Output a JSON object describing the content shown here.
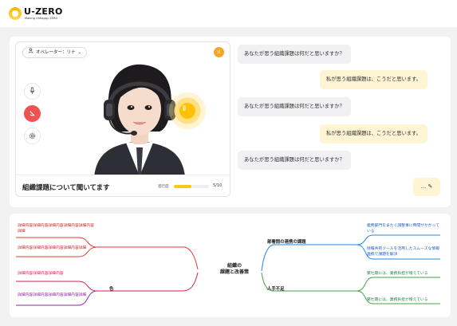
{
  "brand": {
    "name": "U-ZERO",
    "tagline": "Making Unhappy ZERO"
  },
  "video": {
    "operator_label": "オペレーター：リナ",
    "caption": "組織課題について聞いてます",
    "progress_label": "進行度",
    "progress_text": "5/10",
    "progress_fraction": 0.5
  },
  "chat": {
    "messages": [
      {
        "role": "assistant",
        "text": "あなたが思う組織課題は何だと思いますか？"
      },
      {
        "role": "user",
        "text": "私が思う組織課題は、こうだと思います。"
      },
      {
        "role": "assistant",
        "text": "あなたが思う組織課題は何だと思いますか？"
      },
      {
        "role": "user",
        "text": "私が思う組織課題は、こうだと思います。"
      },
      {
        "role": "assistant",
        "text": "あなたが思う組織課題は何だと思いますか？"
      }
    ],
    "compose_label": "..."
  },
  "mindmap": {
    "center": "組織の\n課題と改善策",
    "left_label": "色",
    "left_items": [
      "詳細内容詳細内容詳細内容詳細内容詳細内容詳細",
      "詳細内容詳細内容詳細内容詳細内容詳細",
      "詳細内容詳細内容詳細内容",
      "詳細内容詳細内容詳細内容詳細内容詳細"
    ],
    "right_branches": [
      {
        "label": "部署間の連携の課題",
        "items": [
          "義務部門をまたぐ調整事に時間がかかっている",
          "情報共有ツールを活用したスムーズな情報連携で課題を解決"
        ]
      },
      {
        "label": "人手不足",
        "items": [
          "繁忙期には、業務負担が増えている",
          "繁忙期には、業務負担が増えている"
        ]
      }
    ],
    "colors": {
      "left_a": "#e53935",
      "left_b": "#d81b60",
      "left_c": "#8e24aa",
      "right_top": "#1e88e5",
      "right_bottom": "#43a047"
    }
  }
}
